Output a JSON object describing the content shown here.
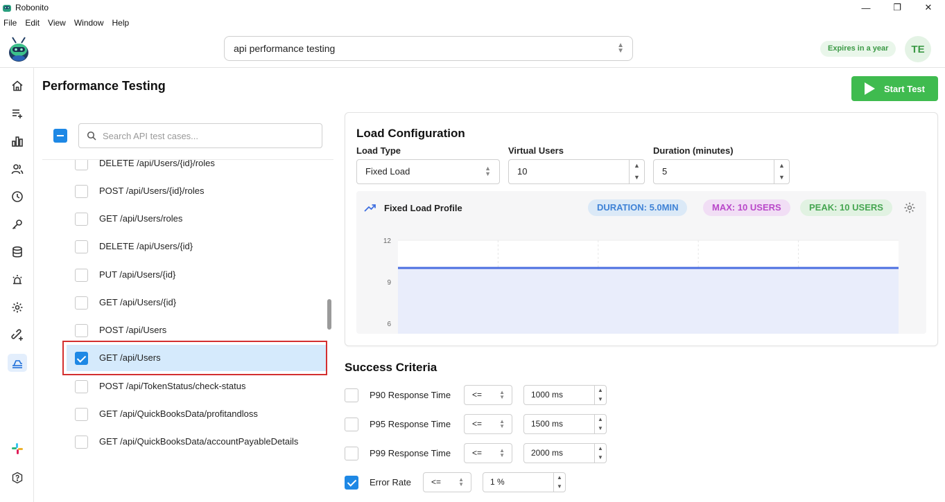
{
  "window": {
    "title": "Robonito",
    "minimize_glyph": "—",
    "maximize_glyph": "❐",
    "close_glyph": "✕"
  },
  "menu": [
    "File",
    "Edit",
    "View",
    "Window",
    "Help"
  ],
  "header": {
    "project": "api performance testing",
    "expires": "Expires in a year",
    "avatar": "TE"
  },
  "sidebar": {
    "icons": [
      "home-icon",
      "add-list-icon",
      "bar-chart-icon",
      "users-icon",
      "clock-icon",
      "wrench-icon",
      "database-icon",
      "alarm-icon",
      "settings-gear-icon",
      "link-plus-icon",
      "performance-icon",
      "slack-icon",
      "help-icon"
    ],
    "active": "performance-icon"
  },
  "page": {
    "title": "Performance Testing",
    "start_button": "Start Test"
  },
  "test_list": {
    "search_placeholder": "Search API test cases...",
    "items": [
      {
        "label": "DELETE /api/Users/{id}/roles",
        "checked": false
      },
      {
        "label": "POST /api/Users/{id}/roles",
        "checked": false
      },
      {
        "label": "GET /api/Users/roles",
        "checked": false
      },
      {
        "label": "DELETE /api/Users/{id}",
        "checked": false
      },
      {
        "label": "PUT /api/Users/{id}",
        "checked": false
      },
      {
        "label": "GET /api/Users/{id}",
        "checked": false
      },
      {
        "label": "POST /api/Users",
        "checked": false
      },
      {
        "label": "GET /api/Users",
        "checked": true
      },
      {
        "label": "POST /api/TokenStatus/check-status",
        "checked": false
      },
      {
        "label": "GET /api/QuickBooksData/profitandloss",
        "checked": false
      },
      {
        "label": "GET /api/QuickBooksData/accountPayableDetails",
        "checked": false
      }
    ]
  },
  "load_config": {
    "title": "Load Configuration",
    "load_type_label": "Load Type",
    "load_type_value": "Fixed Load",
    "virtual_users_label": "Virtual Users",
    "virtual_users_value": "10",
    "duration_label": "Duration (minutes)",
    "duration_value": "5",
    "profile_title": "Fixed Load Profile",
    "chip_duration": "DURATION: 5.0MIN",
    "chip_max": "MAX: 10 USERS",
    "chip_peak": "PEAK: 10 USERS",
    "colors": {
      "line": "#4a6ee0",
      "fill": "#e9edfb",
      "duration_chip": "#3f82d6",
      "max_chip": "#b948c9",
      "peak_chip": "#46a651"
    }
  },
  "chart_data": {
    "type": "area",
    "title": "",
    "xlabel": "",
    "ylabel": "",
    "yticks": [
      "12",
      "9",
      "6"
    ],
    "ylim": [
      6,
      12
    ],
    "series": [
      {
        "values": [
          10,
          10
        ]
      }
    ],
    "grid": true
  },
  "success_criteria": {
    "title": "Success Criteria",
    "rows": [
      {
        "label": "P90 Response Time",
        "op": "<=",
        "value": "1000 ms",
        "checked": false
      },
      {
        "label": "P95 Response Time",
        "op": "<=",
        "value": "1500 ms",
        "checked": false
      },
      {
        "label": "P99 Response Time",
        "op": "<=",
        "value": "2000 ms",
        "checked": false
      },
      {
        "label": "Error Rate",
        "op": "<=",
        "value": "1 %",
        "checked": true
      }
    ]
  }
}
